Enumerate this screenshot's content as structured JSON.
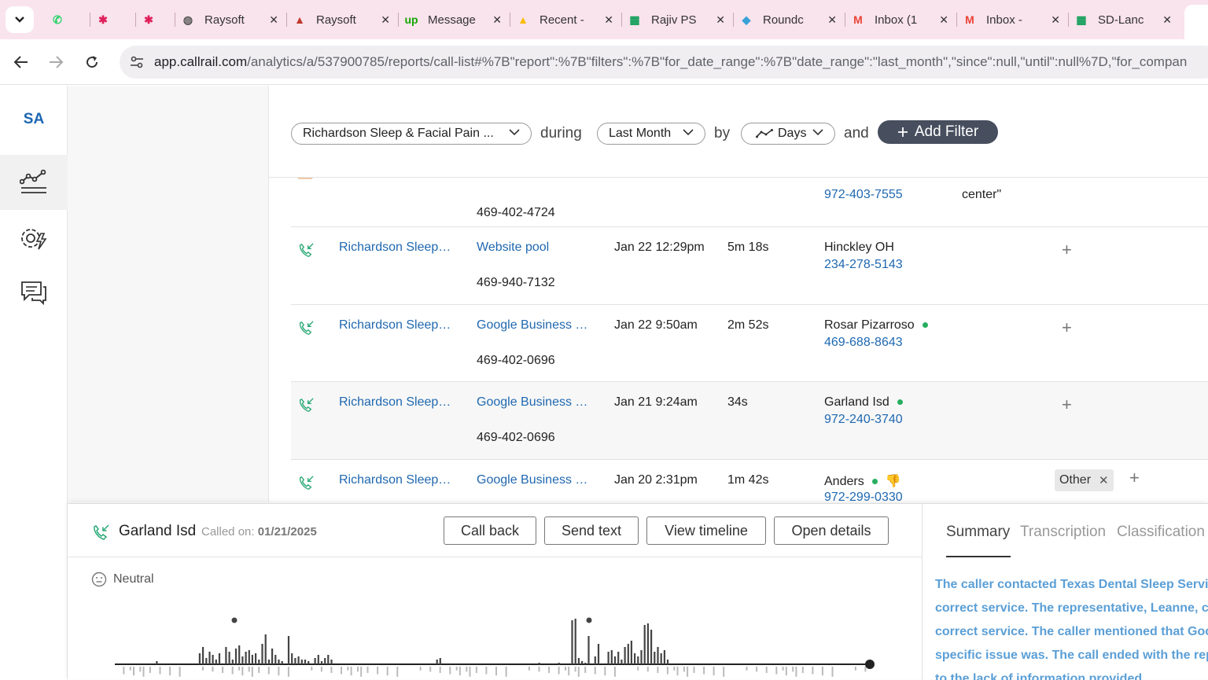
{
  "browser": {
    "tabs": [
      {
        "title": "",
        "icon": "whatsapp-icon",
        "color": "#25d366"
      },
      {
        "title": "",
        "icon": "slack-icon",
        "color": "#e01e5a"
      },
      {
        "title": "",
        "icon": "slack-icon",
        "color": "#e01e5a"
      },
      {
        "title": "Raysoft",
        "icon": "globe-icon",
        "color": "#555555"
      },
      {
        "title": "Raysoft",
        "icon": "raysoft-icon",
        "color": "#c0392b"
      },
      {
        "title": "Message",
        "icon": "upwork-icon",
        "color": "#14a800"
      },
      {
        "title": "Recent -",
        "icon": "drive-icon",
        "color": "#fbbc04"
      },
      {
        "title": "Rajiv PS",
        "icon": "sheets-icon",
        "color": "#0f9d58"
      },
      {
        "title": "Roundc",
        "icon": "roundcube-icon",
        "color": "#37a1d8"
      },
      {
        "title": "Inbox (1",
        "icon": "gmail-icon",
        "color": "#ea4335"
      },
      {
        "title": "Inbox -",
        "icon": "gmail-icon",
        "color": "#ea4335"
      },
      {
        "title": "SD-Lanc",
        "icon": "sheets-icon",
        "color": "#0f9d58"
      }
    ],
    "url_host": "app.callrail.com",
    "url_rest": "/analytics/a/537900785/reports/call-list#%7B\"report\":%7B\"filters\":%7B\"for_date_range\":%7B\"date_range\":\"last_month\",\"since\":null,\"until\":null%7D,\"for_compan"
  },
  "rail": {
    "logo": "SA",
    "items": [
      "analytics-icon",
      "settings-icon",
      "chat-icon"
    ]
  },
  "filters": {
    "company": "Richardson Sleep & Facial Pain ...",
    "during_label": "during",
    "date_range": "Last Month",
    "by_label": "by",
    "interval": "Days",
    "and_label": "and",
    "add_filter": "Add Filter"
  },
  "calls": {
    "partial_row": {
      "source_number": "469-402-4724",
      "caller_number": "972-403-7555",
      "note": "center\""
    },
    "rows": [
      {
        "company": "Richardson Sleep…",
        "source": "Website pool",
        "tracking_number": "469-940-7132",
        "date": "Jan 22 12:29pm",
        "duration": "5m 18s",
        "caller_name": "Hinckley OH",
        "caller_number": "234-278-5143",
        "online": false,
        "tag": ""
      },
      {
        "company": "Richardson Sleep…",
        "source": "Google Business …",
        "tracking_number": "469-402-0696",
        "date": "Jan 22 9:50am",
        "duration": "2m 52s",
        "caller_name": "Rosar Pizarroso",
        "caller_number": "469-688-8643",
        "online": true,
        "tag": ""
      },
      {
        "company": "Richardson Sleep…",
        "source": "Google Business …",
        "tracking_number": "469-402-0696",
        "date": "Jan 21 9:24am",
        "duration": "34s",
        "caller_name": "Garland Isd",
        "caller_number": "972-240-3740",
        "online": true,
        "tag": ""
      },
      {
        "company": "Richardson Sleep…",
        "source": "Google Business …",
        "tracking_number": "",
        "date": "Jan 20 2:31pm",
        "duration": "1m 42s",
        "caller_name": "Anders",
        "caller_number": "972-299-0330",
        "online": true,
        "tag": "Other"
      }
    ]
  },
  "detail": {
    "caller_name": "Garland Isd",
    "called_on_label": "Called on:",
    "called_on_date": "01/21/2025",
    "buttons": [
      "Call back",
      "Send text",
      "View timeline",
      "Open details"
    ],
    "sentiment": "Neutral",
    "tabs": [
      "Summary",
      "Transcription",
      "Classification"
    ],
    "summary_lines": [
      "The caller contacted Texas Dental Sleep Service",
      "correct service. The representative, Leanne, co",
      "correct service. The caller mentioned that Goog",
      "specific issue was. The call ended with the repr",
      "to the lack of information provided."
    ]
  },
  "colors": {
    "accent": "#1f68b0",
    "online": "#27ae60",
    "call_icon": "#2aa876"
  }
}
